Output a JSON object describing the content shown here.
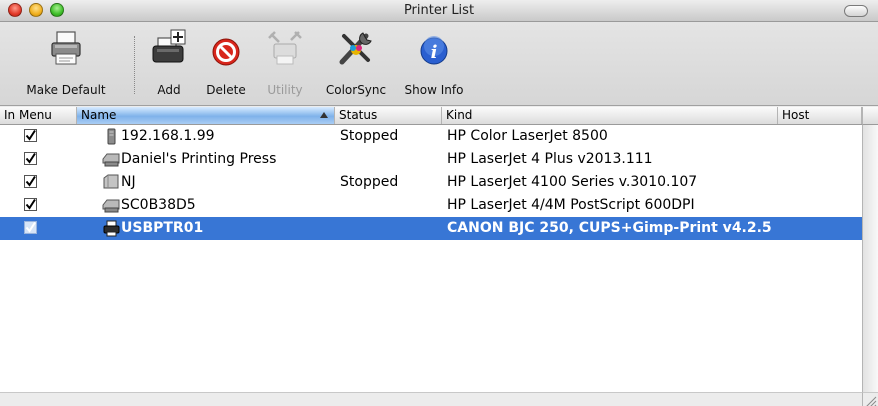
{
  "window": {
    "title": "Printer List",
    "buttons": [
      "close",
      "minimize",
      "zoom"
    ]
  },
  "toolbar": {
    "items": [
      {
        "label": "Make Default",
        "icon": "printer-default-icon",
        "enabled": true
      },
      {
        "label": "Add",
        "icon": "add-printer-icon",
        "enabled": true
      },
      {
        "label": "Delete",
        "icon": "delete-icon",
        "enabled": true
      },
      {
        "label": "Utility",
        "icon": "utility-icon",
        "enabled": false
      },
      {
        "label": "ColorSync",
        "icon": "colorsync-icon",
        "enabled": true
      },
      {
        "label": "Show Info",
        "icon": "info-icon",
        "enabled": true
      }
    ]
  },
  "table": {
    "columns": [
      "In Menu",
      "Name",
      "Status",
      "Kind",
      "Host"
    ],
    "sorted_by": "Name",
    "sort_direction": "ascending",
    "rows": [
      {
        "in_menu": true,
        "icon": "network-printer-icon",
        "name": "192.168.1.99",
        "status": "Stopped",
        "kind": "HP Color LaserJet 8500",
        "host": "",
        "selected": false
      },
      {
        "in_menu": true,
        "icon": "shared-printer-icon",
        "name": "Daniel's Printing Press",
        "status": "",
        "kind": "HP LaserJet 4 Plus v2013.111",
        "host": "",
        "selected": false
      },
      {
        "in_menu": true,
        "icon": "generic-printer-icon",
        "name": "NJ",
        "status": "Stopped",
        "kind": "HP LaserJet 4100 Series v.3010.107",
        "host": "",
        "selected": false
      },
      {
        "in_menu": true,
        "icon": "shared-printer-icon",
        "name": "SC0B38D5",
        "status": "",
        "kind": "HP LaserJet 4/4M PostScript 600DPI",
        "host": "",
        "selected": false
      },
      {
        "in_menu": true,
        "icon": "usb-printer-icon",
        "name": "USBPTR01",
        "status": "",
        "kind": "CANON BJC 250, CUPS+Gimp-Print v4.2.5",
        "host": "",
        "selected": true
      }
    ]
  },
  "colors": {
    "selection": "#3876d5",
    "sorted_header": "#7fb2ea",
    "delete_red": "#d8261c",
    "info_blue": "#2a5fd0"
  }
}
